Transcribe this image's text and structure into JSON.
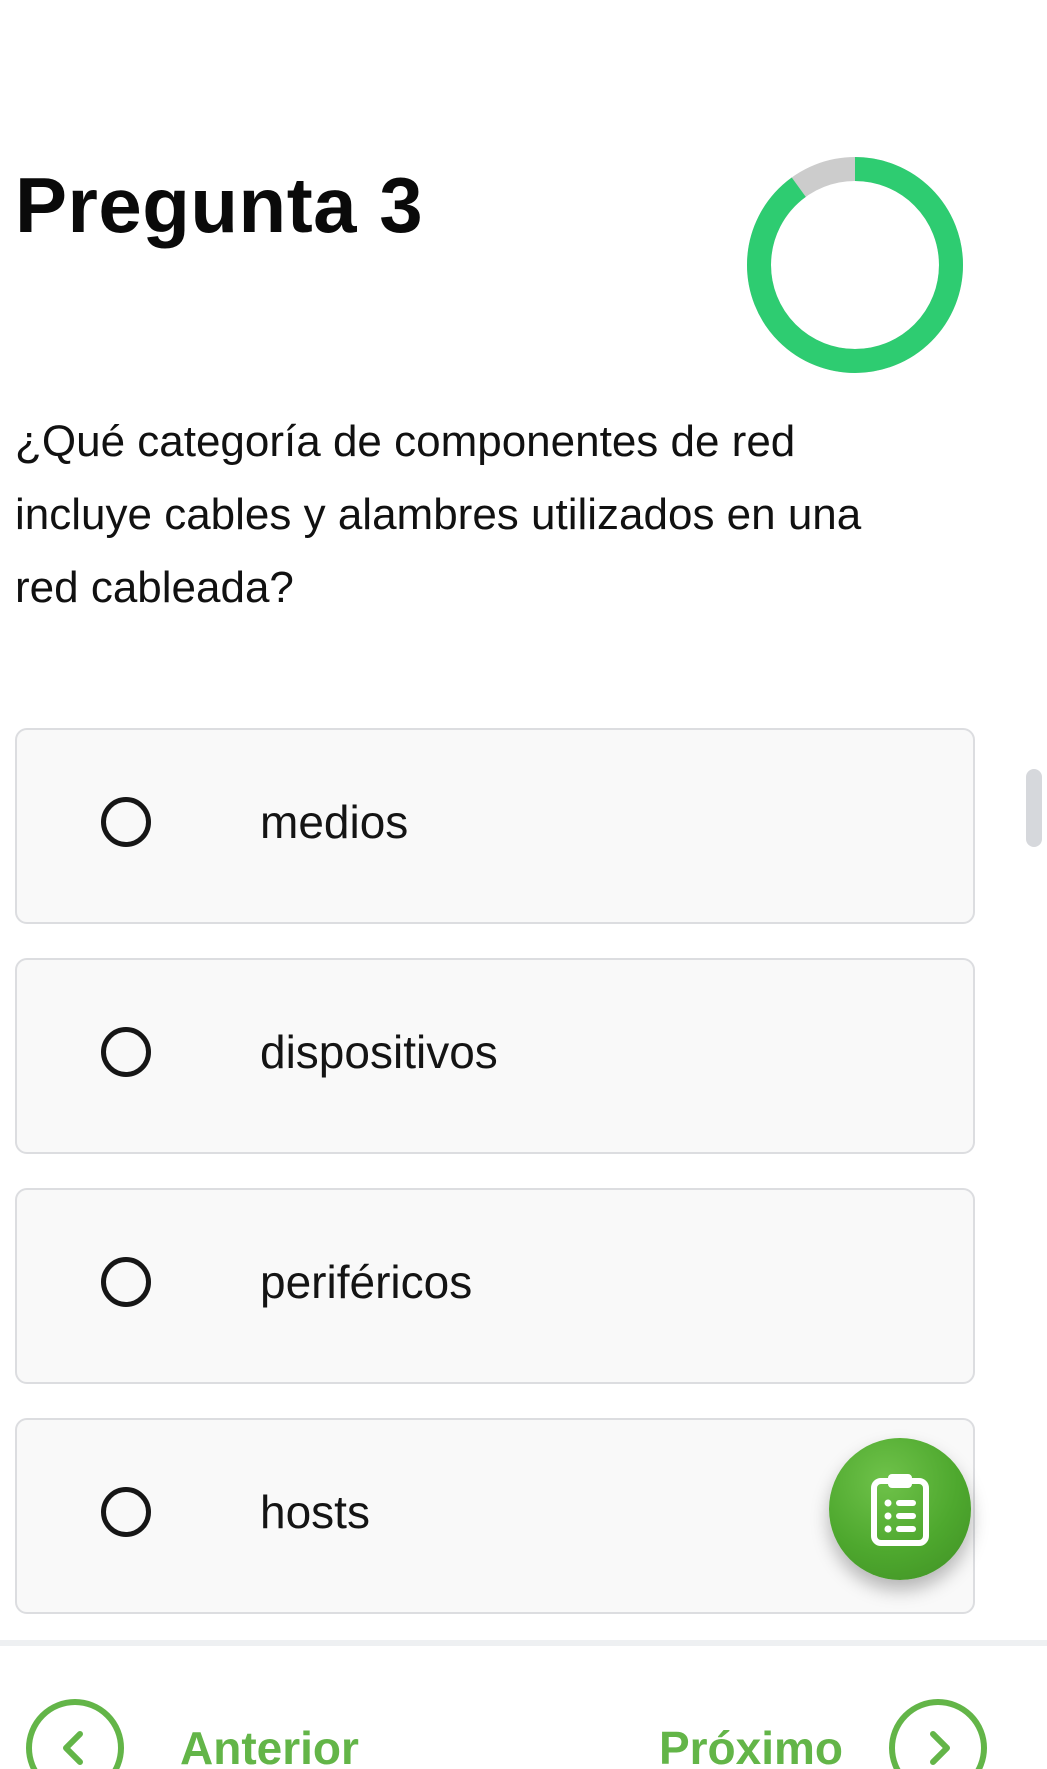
{
  "question": {
    "title": "Pregunta 3",
    "text": "¿Qué categoría de componentes de red incluye cables y alambres utilizados en una red cableada?"
  },
  "timer": {
    "remaining_fraction": 0.9,
    "colors": {
      "remaining": "#2ecc71",
      "elapsed": "#cccccc"
    }
  },
  "answers": [
    {
      "label": "medios"
    },
    {
      "label": "dispositivos"
    },
    {
      "label": "periféricos"
    },
    {
      "label": "hosts"
    }
  ],
  "fab": {
    "icon": "clipboard-list-icon",
    "color": "#4ea82e"
  },
  "navigation": {
    "previous_label": "Anterior",
    "next_label": "Próximo",
    "previous_icon": "chevron-left-icon",
    "next_icon": "chevron-right-icon",
    "accent": "#63b548"
  }
}
